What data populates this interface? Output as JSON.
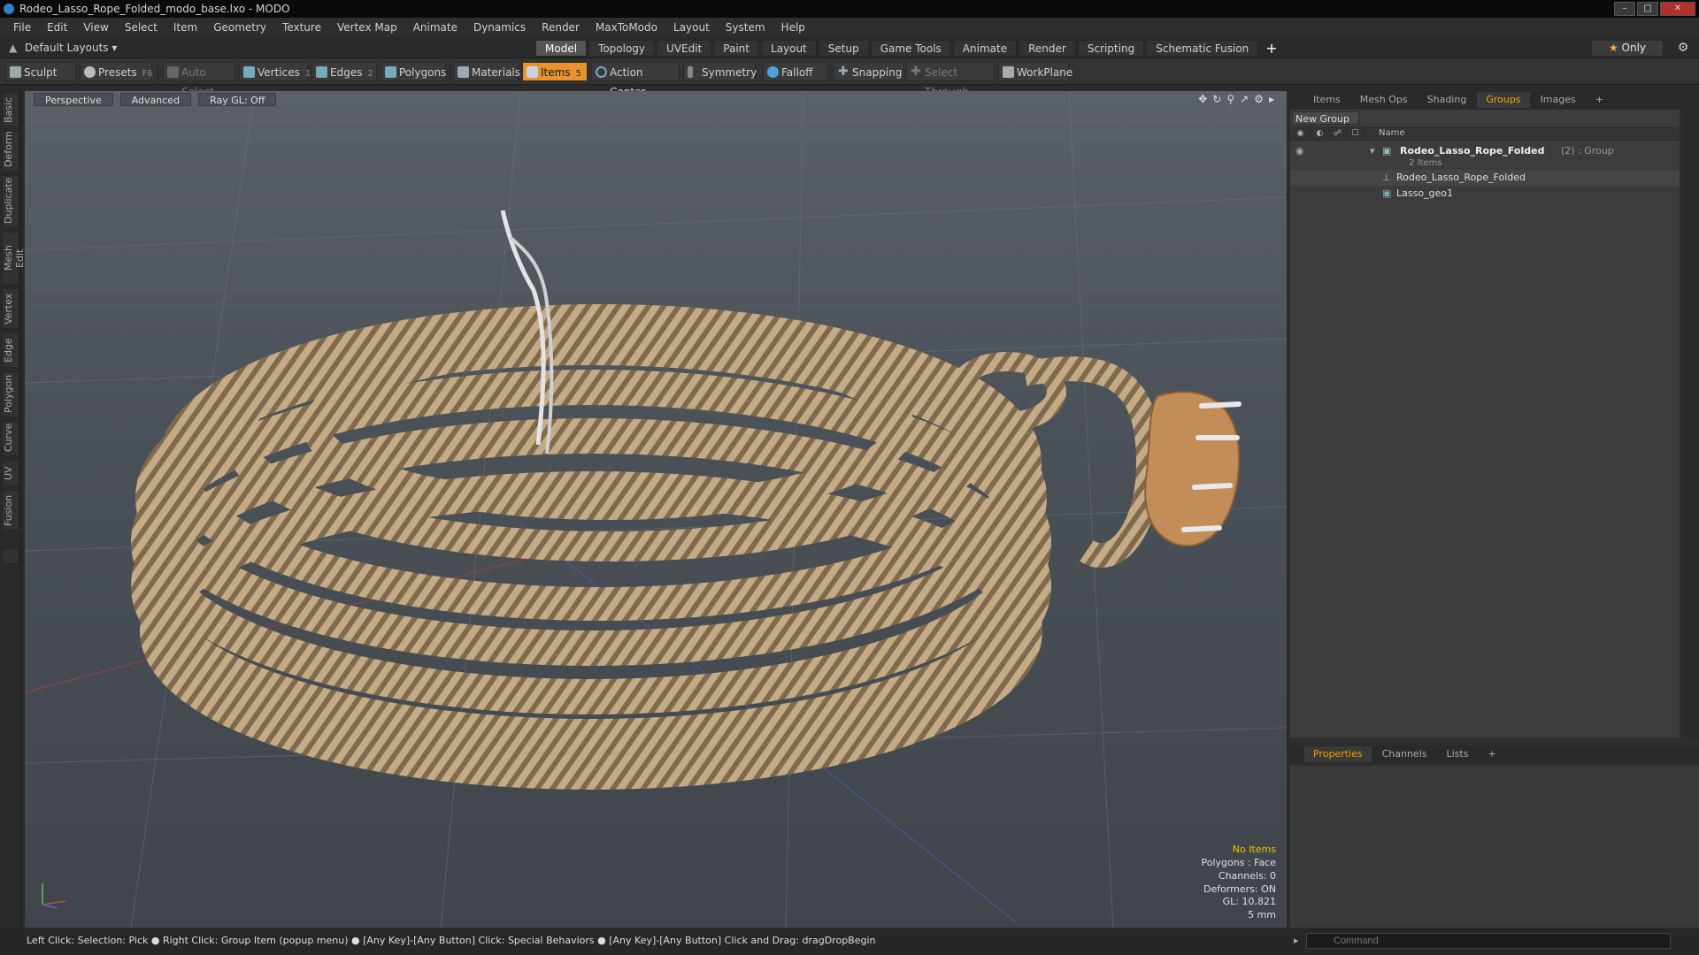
{
  "window": {
    "title": "Rodeo_Lasso_Rope_Folded_modo_base.lxo - MODO"
  },
  "menu": [
    "File",
    "Edit",
    "View",
    "Select",
    "Item",
    "Geometry",
    "Texture",
    "Vertex Map",
    "Animate",
    "Dynamics",
    "Render",
    "MaxToModo",
    "Layout",
    "System",
    "Help"
  ],
  "layout": {
    "selector": "Default Layouts ▾",
    "tabs": [
      "Model",
      "Topology",
      "UVEdit",
      "Paint",
      "Layout",
      "Setup",
      "Game Tools",
      "Animate",
      "Render",
      "Scripting",
      "Schematic Fusion"
    ],
    "active_tab": "Model",
    "only_label": "Only"
  },
  "toolbar": {
    "sculpt": "Sculpt",
    "presets": "Presets",
    "presets_key": "F6",
    "auto_select": "Auto Select",
    "vertices": "Vertices",
    "vertices_count": "1",
    "edges": "Edges",
    "edges_count": "2",
    "polygons": "Polygons",
    "materials": "Materials",
    "items": "Items",
    "items_count": "5",
    "action_center": "Action Center",
    "symmetry": "Symmetry",
    "falloff": "Falloff",
    "snapping": "Snapping",
    "select_through": "Select Through",
    "workplane": "WorkPlane"
  },
  "left_tabs": [
    "Basic",
    "Deform",
    "Duplicate",
    "Mesh Edit",
    "Vertex",
    "Edge",
    "Polygon",
    "Curve",
    "UV",
    "Fusion"
  ],
  "viewport": {
    "view": "Perspective",
    "shading": "Advanced",
    "raygl": "Ray GL: Off",
    "hud": {
      "items": "No Items",
      "polygons": "Polygons : Face",
      "channels": "Channels: 0",
      "deformers": "Deformers: ON",
      "gl": "GL: 10,821",
      "unit": "5 mm"
    }
  },
  "panel": {
    "tabs": [
      "Items",
      "Mesh Ops",
      "Shading",
      "Groups",
      "Images"
    ],
    "active_tab": "Groups",
    "new_group": "New Group",
    "name_header": "Name",
    "group_name": "Rodeo_Lasso_Rope_Folded",
    "group_meta": "(2) : Group",
    "group_count": "2 Items",
    "children": [
      "Rodeo_Lasso_Rope_Folded",
      "Lasso_geo1"
    ]
  },
  "props": {
    "tabs": [
      "Properties",
      "Channels",
      "Lists"
    ],
    "active_tab": "Properties"
  },
  "status": {
    "text": "Left Click: Selection: Pick ● Right Click: Group Item (popup menu) ● [Any Key]-[Any Button] Click: Special Behaviors ● [Any Key]-[Any Button] Click and Drag: dragDropBegin",
    "command_placeholder": "Command"
  },
  "colors": {
    "accent": "#e8932c",
    "active_tab_text": "#f0a000",
    "hud_warn": "#f0c000"
  }
}
